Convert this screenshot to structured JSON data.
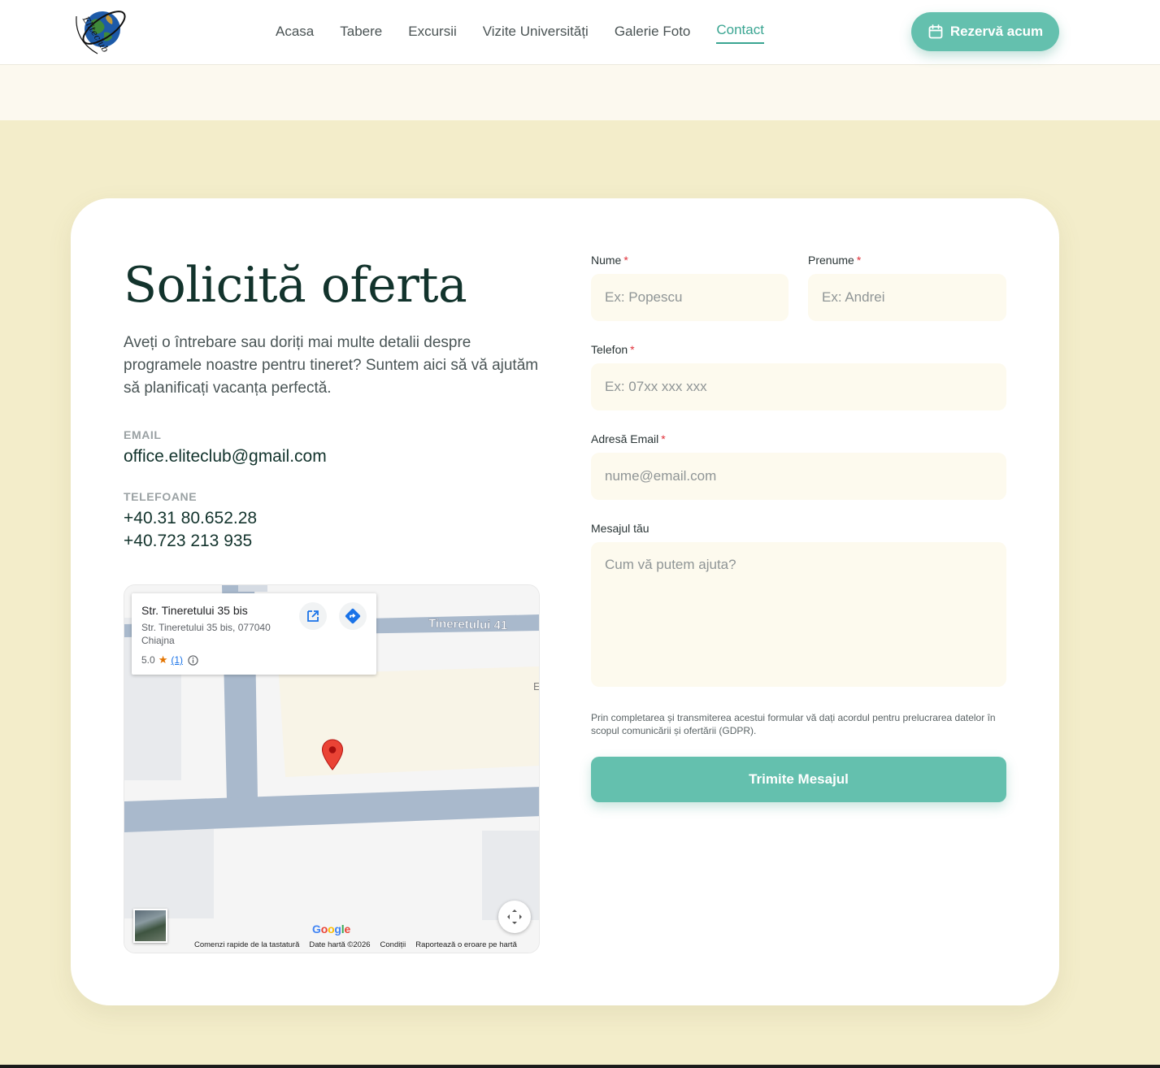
{
  "header": {
    "logo_text": "Eliteclub",
    "nav": [
      "Acasa",
      "Tabere",
      "Excursii",
      "Vizite Universități",
      "Galerie Foto",
      "Contact"
    ],
    "active_nav": "Contact",
    "cta_label": "Rezervă acum",
    "cta_icon": "calendar-icon"
  },
  "contact": {
    "title": "Solicită oferta",
    "intro": "Aveți o întrebare sau doriți mai multe detalii despre programele noastre pentru tineret? Suntem aici să vă ajutăm să planificați vacanța perfectă.",
    "email_label": "EMAIL",
    "email": "office.eliteclub@gmail.com",
    "phones_label": "TELEFOANE",
    "phones": [
      "+40.31 80.652.28",
      "+40.723 213 935"
    ]
  },
  "map": {
    "place_name": "Str. Tineretului 35 bis",
    "place_address": "Str. Tineretului 35 bis, 077040 Chiajna",
    "rating": "5.0",
    "rating_count": "(1)",
    "street_label": "Tineretului 41",
    "partial_label": "E",
    "google_logo": "Google",
    "attribution": [
      "Comenzi rapide de la tastatură",
      "Date hartă ©2026",
      "Condiții",
      "Raportează o eroare pe hartă"
    ]
  },
  "form": {
    "nume_label": "Nume",
    "nume_placeholder": "Ex: Popescu",
    "prenume_label": "Prenume",
    "prenume_placeholder": "Ex: Andrei",
    "telefon_label": "Telefon",
    "telefon_placeholder": "Ex: 07xx xxx xxx",
    "email_label": "Adresă Email",
    "email_placeholder": "nume@email.com",
    "message_label": "Mesajul tău",
    "message_placeholder": "Cum vă putem ajuta?",
    "required_mark": "*",
    "gdpr": "Prin completarea și transmiterea acestui formular vă dați acordul pentru prelucrarea datelor în scopul comunicării și ofertării (GDPR).",
    "submit_label": "Trimite Mesajul"
  },
  "colors": {
    "accent": "#64c0ae",
    "accent_text": "#3aa592",
    "page_bg": "#f3edca",
    "input_bg": "#fdfaee",
    "title": "#12332c",
    "required": "#e0313a"
  }
}
